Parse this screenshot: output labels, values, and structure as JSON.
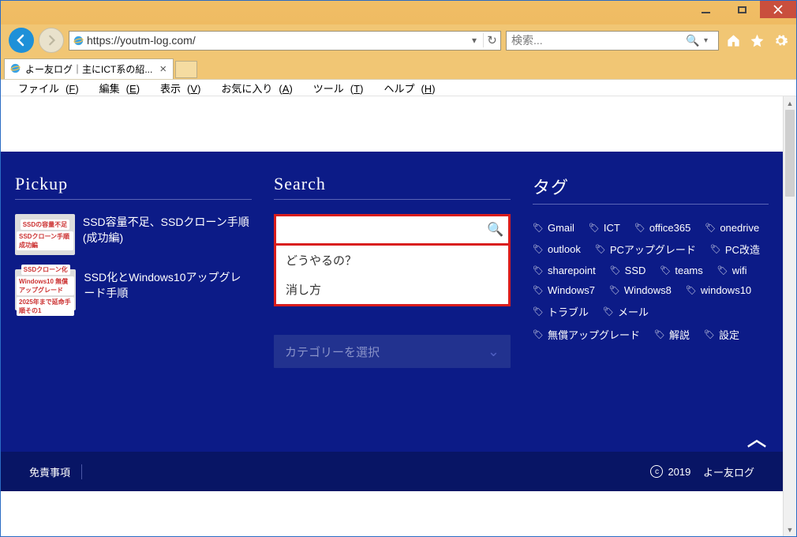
{
  "window": {
    "address_url": "https://youtm-log.com/",
    "search_placeholder": "検索...",
    "tab_title": "よー友ログ｜主にICT系の紹...",
    "menus": {
      "file": {
        "label": "ファイル",
        "accel": "F"
      },
      "edit": {
        "label": "編集",
        "accel": "E"
      },
      "view": {
        "label": "表示",
        "accel": "V"
      },
      "fav": {
        "label": "お気に入り",
        "accel": "A"
      },
      "tool": {
        "label": "ツール",
        "accel": "T"
      },
      "help": {
        "label": "ヘルプ",
        "accel": "H"
      }
    }
  },
  "page": {
    "headings": {
      "pickup": "Pickup",
      "search": "Search",
      "tags": "タグ"
    },
    "pickup": [
      {
        "title": "SSD容量不足、SSDクローン手順(成功編)",
        "thumb_lines": [
          "SSDの容量不足",
          "SSDクローン手順 成功編"
        ]
      },
      {
        "title": "SSD化とWindows10アップグレード手順",
        "thumb_lines": [
          "SSDクローン化",
          "Windows10 無償アップグレード",
          "2025年まで延命手順その1"
        ]
      }
    ],
    "search": {
      "input_value": "",
      "suggestions": [
        "どうやるの？",
        "消し方"
      ]
    },
    "category_select": {
      "placeholder": "カテゴリーを選択"
    },
    "tags": [
      "Gmail",
      "ICT",
      "office365",
      "onedrive",
      "outlook",
      "PCアップグレード",
      "PC改造",
      "sharepoint",
      "SSD",
      "teams",
      "wifi",
      "Windows7",
      "Windows8",
      "windows10",
      "トラブル",
      "メール",
      "無償アップグレード",
      "解説",
      "設定"
    ],
    "footer": {
      "disclaimer": "免責事項",
      "copyright_year": "2019",
      "copyright_name": "よー友ログ"
    }
  }
}
